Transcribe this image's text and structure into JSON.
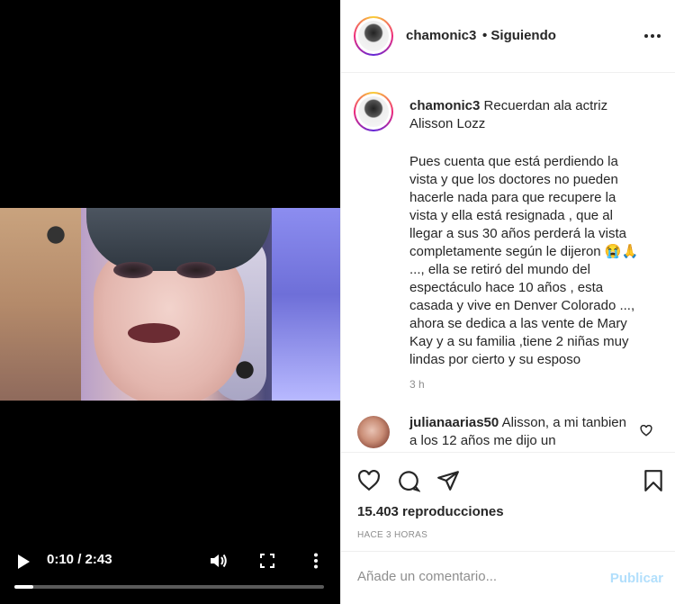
{
  "video": {
    "time": "0:10 / 2:43",
    "progress": 0.06,
    "icons": {
      "play": "play-icon",
      "volume": "volume-icon",
      "fullscreen": "fullscreen-icon",
      "more": "more-vertical-icon"
    }
  },
  "header": {
    "username": "chamonic3",
    "follow_status": "• Siguiendo"
  },
  "caption": {
    "username": "chamonic3",
    "intro": "Recuerdan ala actriz Alisson Lozz",
    "body": "Pues cuenta que está perdiendo la vista y que los doctores no pueden hacerle nada para que recupere la vista y ella está resignada , que al llegar a sus 30 años perderá la vista completamente según le dijeron 😭🙏 ..., ella se retiró del mundo del espectáculo hace 10 años , esta casada y vive en Denver Colorado ..., ahora se dedica a las vente de Mary Kay y a su familia ,tiene 2 niñas muy lindas por cierto y su esposo",
    "time": "3 h"
  },
  "comment": {
    "username": "julianaarias50",
    "text": "Alisson, a mi tanbien a los 12 años me dijo un"
  },
  "stats": {
    "views": "15.403 reproducciones",
    "ago": "HACE 3 HORAS"
  },
  "add_comment": {
    "placeholder": "Añade un comentario...",
    "publish": "Publicar"
  },
  "colors": {
    "link": "#b2dffc",
    "muted": "#8e8e8e",
    "text": "#262626"
  }
}
